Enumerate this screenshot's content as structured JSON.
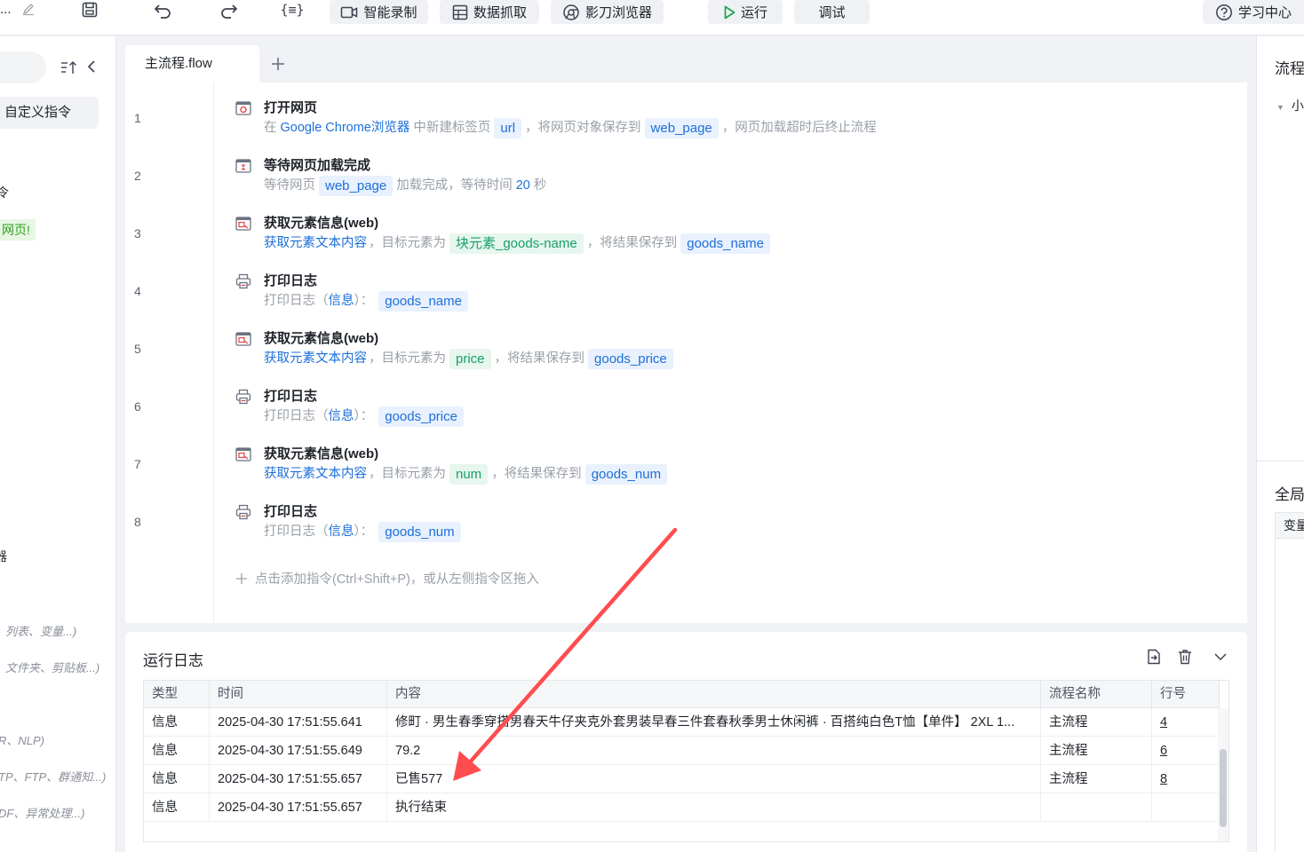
{
  "toolbar": {
    "title": "...",
    "buttons": {
      "smart_record": "智能录制",
      "data_capture": "数据抓取",
      "browser": "影刀浏览器",
      "run": "运行",
      "debug": "调试",
      "learn_center": "学习中心"
    },
    "icons": [
      "edit-icon",
      "save-icon",
      "undo-icon",
      "redo-icon",
      "variable-icon"
    ]
  },
  "sidebar": {
    "custom_commands": "自定义指令",
    "fragments": [
      "令",
      "网页!",
      "器"
    ],
    "hints": [
      "列表、变量...)",
      "文件夹、剪贴板...)",
      "R、NLP)",
      "TP、FTP、群通知...)",
      "DF、异常处理...)"
    ]
  },
  "editor": {
    "tab": "主流程.flow",
    "add_hint": "点击添加指令(Ctrl+Shift+P)，或从左侧指令区拖入",
    "steps": [
      {
        "line": "1",
        "icon": "open-webpage-icon",
        "title": "打开网页",
        "desc": {
          "t1": "在",
          "l1": "Google Chrome浏览器",
          "t2": "中新建标签页",
          "c1": "url",
          "t3": "，将网页对象保存到",
          "c2": "web_page",
          "t4": "，网页加载超时后终止流程"
        }
      },
      {
        "line": "2",
        "icon": "wait-page-load-icon",
        "title": "等待网页加载完成",
        "desc": {
          "t1": "等待网页",
          "c1": "web_page",
          "t2": "加载完成，等待时间",
          "l1": "20",
          "t3": "秒"
        }
      },
      {
        "line": "3",
        "icon": "get-element-info-icon",
        "title": "获取元素信息(web)",
        "desc": {
          "l1": "获取元素文本内容",
          "t1": "，目标元素为",
          "g1": "块元素_goods-name",
          "t2": "，将结果保存到",
          "c1": "goods_name"
        }
      },
      {
        "line": "4",
        "icon": "print-log-icon",
        "title": "打印日志",
        "desc": {
          "t1": "打印日志（",
          "l1": "信息",
          "t2": "）：",
          "c1": "goods_name"
        }
      },
      {
        "line": "5",
        "icon": "get-element-info-icon",
        "title": "获取元素信息(web)",
        "desc": {
          "l1": "获取元素文本内容",
          "t1": "，目标元素为",
          "g1": "price",
          "t2": "，将结果保存到",
          "c1": "goods_price"
        }
      },
      {
        "line": "6",
        "icon": "print-log-icon",
        "title": "打印日志",
        "desc": {
          "t1": "打印日志（",
          "l1": "信息",
          "t2": "）：",
          "c1": "goods_price"
        }
      },
      {
        "line": "7",
        "icon": "get-element-info-icon",
        "title": "获取元素信息(web)",
        "desc": {
          "l1": "获取元素文本内容",
          "t1": "，目标元素为",
          "g1": "num",
          "t2": "，将结果保存到",
          "c1": "goods_num"
        }
      },
      {
        "line": "8",
        "icon": "print-log-icon",
        "title": "打印日志",
        "desc": {
          "t1": "打印日志（",
          "l1": "信息",
          "t2": "）：",
          "c1": "goods_num"
        }
      }
    ]
  },
  "log": {
    "title": "运行日志",
    "columns": [
      "类型",
      "时间",
      "内容",
      "流程名称",
      "行号"
    ],
    "rows": [
      [
        "信息",
        "2025-04-30 17:51:55.641",
        "修町 · 男生春季穿搭男春天牛仔夹克外套男装早春三件套春秋季男士休闲裤 · 百搭纯白色T恤【单件】 2XL 1...",
        "主流程",
        "4"
      ],
      [
        "信息",
        "2025-04-30 17:51:55.649",
        "79.2",
        "主流程",
        "6"
      ],
      [
        "信息",
        "2025-04-30 17:51:55.657",
        "已售577",
        "主流程",
        "8"
      ],
      [
        "信息",
        "2025-04-30 17:51:55.657",
        "执行结束",
        "",
        ""
      ]
    ]
  },
  "right_panel": {
    "flow_label": "流程",
    "tree_item": "小",
    "global_label": "全局",
    "var_header": "变量"
  },
  "colors": {
    "accent_link": "#1e6fd9",
    "chip_bg": "#e8f1fd",
    "element_green": "#16a06a",
    "arrow_red": "#ff4d4f",
    "run_green": "#19a34a"
  }
}
